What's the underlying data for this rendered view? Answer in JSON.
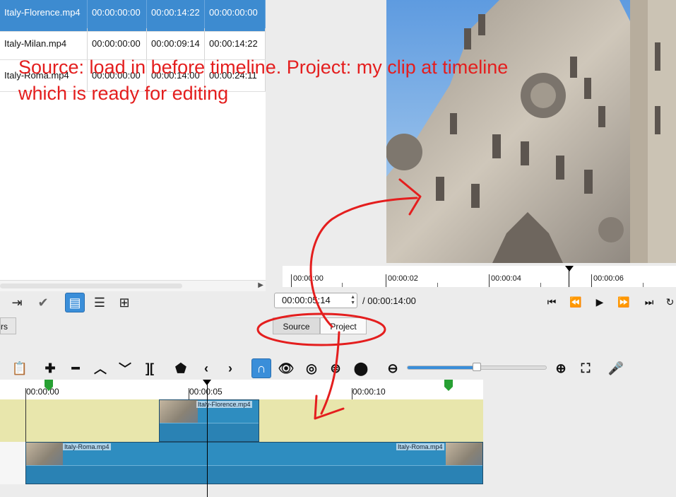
{
  "playlist": {
    "rows": [
      {
        "name": "Italy-Florence.mp4",
        "in": "00:00:00:00",
        "duration": "00:00:14:22",
        "start": "00:00:00:00",
        "selected": true
      },
      {
        "name": "Italy-Milan.mp4",
        "in": "00:00:00:00",
        "duration": "00:00:09:14",
        "start": "00:00:14:22"
      },
      {
        "name": "Italy-Roma.mp4",
        "in": "00:00:00:00",
        "duration": "00:00:14:00",
        "start": "00:00:24:11"
      }
    ]
  },
  "filters_tab": "rs",
  "player": {
    "ruler_labels": [
      "00:00:00",
      "00:00:02",
      "00:00:04",
      "00:00:06"
    ],
    "position": "00:00:05:14",
    "duration": "/ 00:00:14:00",
    "tab_source": "Source",
    "tab_project": "Project"
  },
  "timeline": {
    "ruler_labels": [
      "00:00:00",
      "00:00:05",
      "00:00:10"
    ],
    "clips": {
      "v1": "Italy-Florence.mp4",
      "a1_left": "Italy-Roma.mp4",
      "a1_right": "Italy-Roma.mp4"
    },
    "zoom_level": 0.5
  },
  "annotation": {
    "line1": "Source: load in before timeline. Project: my clip at timeline",
    "line2": "which is ready for editing",
    "color": "#e41e1e"
  },
  "colors": {
    "accent": "#3a8ed9",
    "video_track": "#e8e6ac",
    "clip": "#2e8dc0"
  }
}
